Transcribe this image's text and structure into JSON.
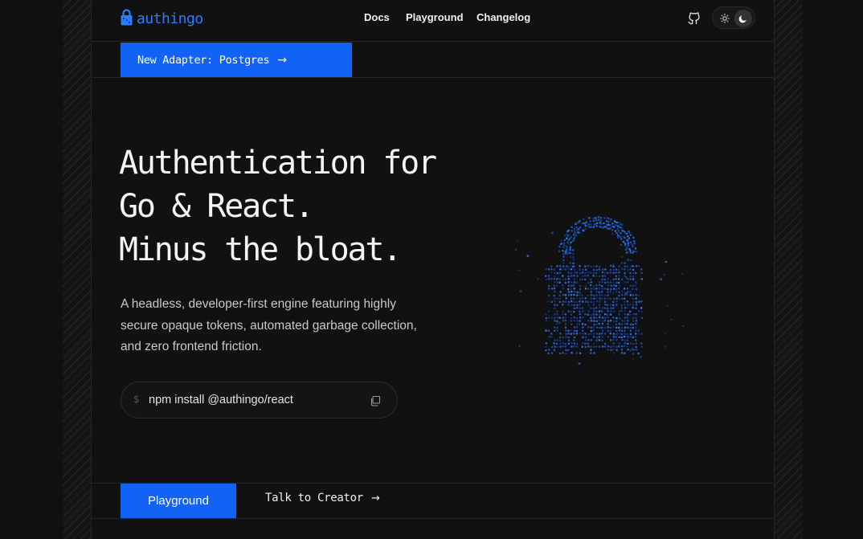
{
  "header": {
    "brand": "authingo",
    "nav": [
      {
        "label": "Docs"
      },
      {
        "label": "Playground"
      },
      {
        "label": "Changelog"
      }
    ],
    "icons": {
      "logo": "lock-icon",
      "github": "github-icon",
      "light": "sun-icon",
      "dark": "moon-icon"
    },
    "theme": "dark"
  },
  "announcement": {
    "label": "New Adapter: Postgres",
    "arrow": "→"
  },
  "hero": {
    "title_lines": [
      "Authentication for",
      "Go & React.",
      "Minus the bloat."
    ],
    "description": "A headless, developer-first engine featuring highly secure opaque tokens, automated garbage collection, and zero frontend friction."
  },
  "install": {
    "prompt": "$",
    "command": "npm install @authingo/react",
    "copy_icon": "copy-icon"
  },
  "cta": {
    "primary": "Playground",
    "secondary": "Talk to Creator",
    "secondary_arrow": "→"
  },
  "colors": {
    "accent": "#1262f5",
    "background": "#111111",
    "text": "#f4f4f4"
  }
}
